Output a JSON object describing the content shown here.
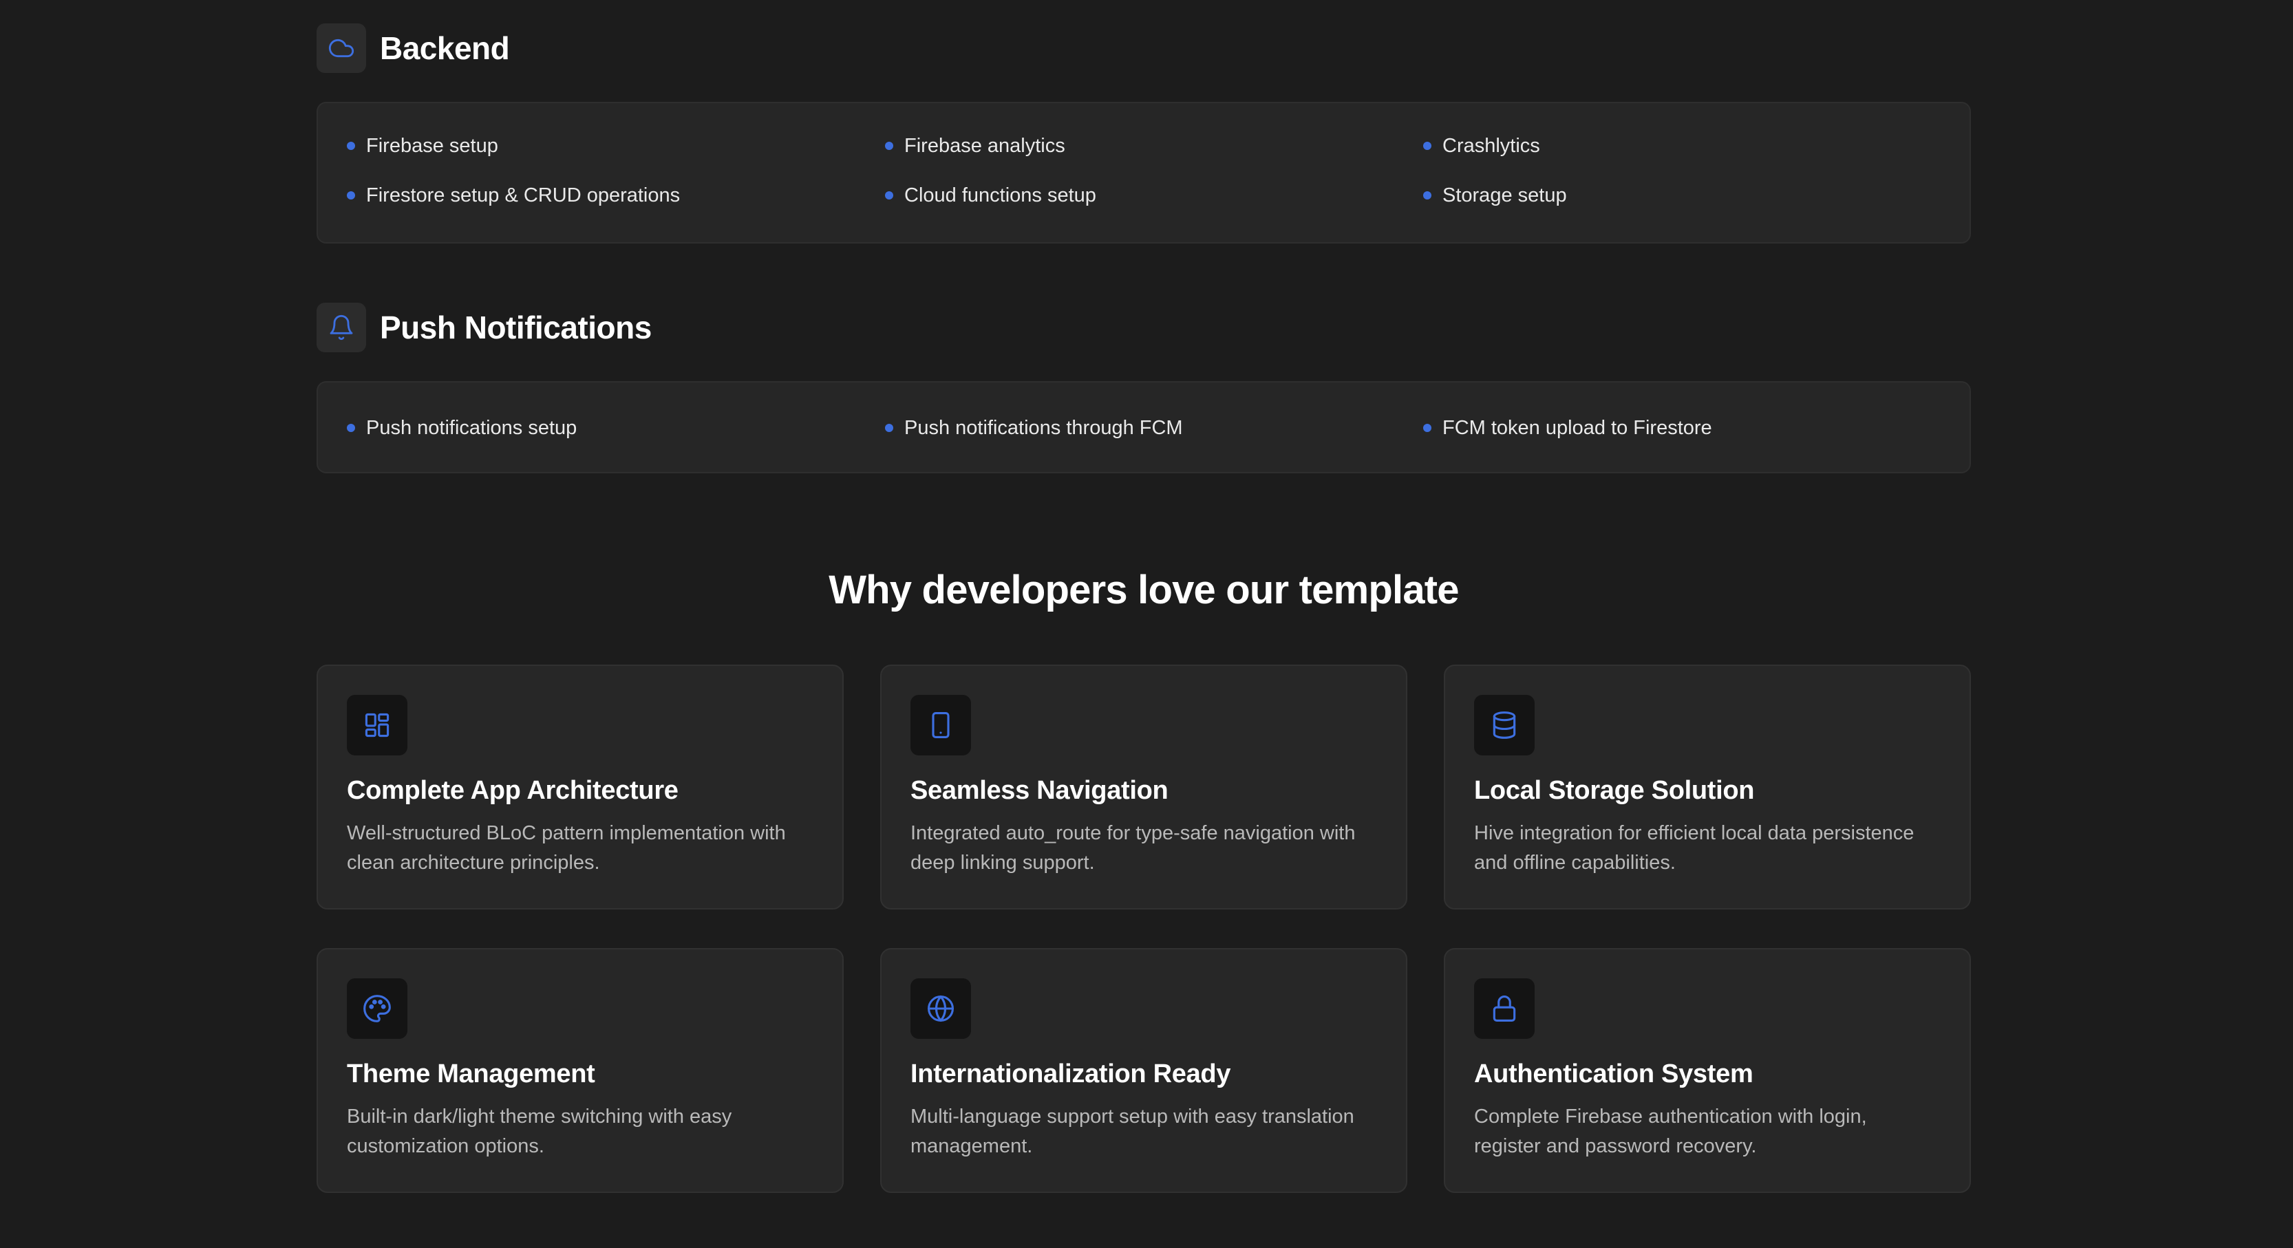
{
  "colors": {
    "background": "#1c1c1c",
    "accent": "#3d6fe0",
    "box": "#262626",
    "card": "#272727"
  },
  "sections": [
    {
      "title": "Backend",
      "icon": "cloud-icon",
      "items": [
        "Firebase setup",
        "Firebase analytics",
        "Crashlytics",
        "Firestore setup & CRUD operations",
        "Cloud functions setup",
        "Storage setup"
      ]
    },
    {
      "title": "Push Notifications",
      "icon": "bell-icon",
      "items": [
        "Push notifications setup",
        "Push notifications through FCM",
        "FCM token upload to Firestore"
      ]
    }
  ],
  "why": {
    "title": "Why developers love our template"
  },
  "features": [
    {
      "icon": "layout-grid-icon",
      "title": "Complete App Architecture",
      "description": "Well-structured BLoC pattern implementation with clean architecture principles."
    },
    {
      "icon": "tablet-icon",
      "title": "Seamless Navigation",
      "description": "Integrated auto_route for type-safe navigation with deep linking support."
    },
    {
      "icon": "database-icon",
      "title": "Local Storage Solution",
      "description": "Hive integration for efficient local data persistence and offline capabilities."
    },
    {
      "icon": "palette-icon",
      "title": "Theme Management",
      "description": "Built-in dark/light theme switching with easy customization options."
    },
    {
      "icon": "globe-icon",
      "title": "Internationalization Ready",
      "description": "Multi-language support setup with easy translation management."
    },
    {
      "icon": "lock-icon",
      "title": "Authentication System",
      "description": "Complete Firebase authentication with login, register and password recovery."
    }
  ]
}
